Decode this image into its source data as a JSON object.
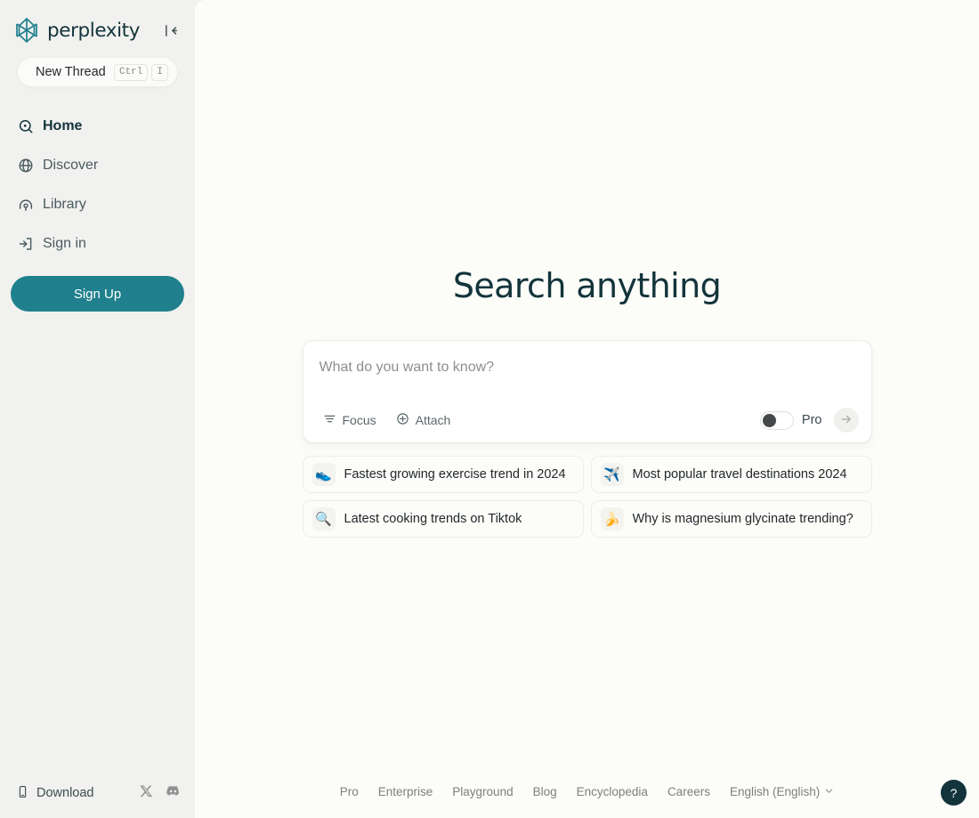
{
  "brand": {
    "name": "perplexity",
    "logo_icon": "perplexity-asterisk-logo",
    "logo_color": "#20808D"
  },
  "sidebar": {
    "collapse_icon": "collapse-sidebar-icon",
    "new_thread": {
      "label": "New Thread",
      "shortcut_keys": [
        "Ctrl",
        "I"
      ]
    },
    "items": [
      {
        "label": "Home",
        "icon": "home-search-icon",
        "active": true
      },
      {
        "label": "Discover",
        "icon": "globe-icon",
        "active": false
      },
      {
        "label": "Library",
        "icon": "library-icon",
        "active": false
      },
      {
        "label": "Sign in",
        "icon": "sign-in-icon",
        "active": false
      }
    ],
    "signup_label": "Sign Up",
    "download_label": "Download",
    "download_icon": "mobile-phone-icon",
    "socials": [
      {
        "name": "x-twitter-icon"
      },
      {
        "name": "discord-icon"
      }
    ]
  },
  "main": {
    "title": "Search anything",
    "search": {
      "placeholder": "What do you want to know?",
      "value": "",
      "focus_label": "Focus",
      "focus_icon": "focus-filter-icon",
      "attach_label": "Attach",
      "attach_icon": "plus-circle-icon",
      "pro_label": "Pro",
      "pro_enabled": false,
      "submit_icon": "arrow-right-icon"
    },
    "suggestions": [
      {
        "emoji": "👟",
        "emoji_name": "sneaker-emoji",
        "text": "Fastest growing exercise trend in 2024"
      },
      {
        "emoji": "✈️",
        "emoji_name": "airplane-emoji",
        "text": "Most popular travel destinations 2024"
      },
      {
        "emoji": "🔍",
        "emoji_name": "magnifying-glass-emoji",
        "text": "Latest cooking trends on Tiktok"
      },
      {
        "emoji": "🍌",
        "emoji_name": "banana-emoji",
        "text": "Why is magnesium glycinate trending?"
      }
    ],
    "footer": {
      "links": [
        "Pro",
        "Enterprise",
        "Playground",
        "Blog",
        "Encyclopedia",
        "Careers"
      ],
      "language": "English (English)"
    },
    "help_label": "?"
  }
}
